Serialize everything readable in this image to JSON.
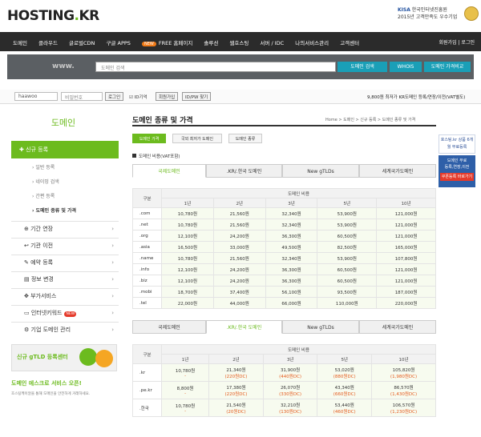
{
  "header": {
    "logo_main": "HOSTING",
    "logo_dot": ".",
    "logo_tail": "KR",
    "kisa_line1_brand": "KISA",
    "kisa_line1": " 한국인터넷진흥원",
    "kisa_line2": "2015년 고객만족도 우수기업"
  },
  "nav": {
    "items": [
      "도메인",
      "클라우드",
      "글로벌CDN",
      "구글 APPS"
    ],
    "new_badge": "NEW",
    "items2": [
      "FREE 홈페이지",
      "솔루션",
      "웹호스팅",
      "서버 / IDC",
      "나의서비스관리",
      "고객센터"
    ],
    "right": "회원가입 | 로그인"
  },
  "search": {
    "www": "www.",
    "placeholder": "도메인 검색",
    "btn_search": "도메인 검색",
    "btn_whois": "WHOIS",
    "btn_compare": "도메인 가격비교"
  },
  "login": {
    "id_value": "haawoo",
    "pw_placeholder": "비밀번호",
    "login_btn": "로그인",
    "save_id": "ID기억",
    "join_btn": "회원가입",
    "find_btn": "ID/PW 찾기",
    "info": "9,800원 최저가 KR도메인 등록/연장/이전(VAT별도)"
  },
  "sidebar": {
    "heading": "도메인",
    "active": "신규 등록",
    "subitems": [
      "일반 등록",
      "네이밍 검색",
      "간편 등록",
      "도메인 종류 및 가격"
    ],
    "menus": [
      {
        "label": "기간 연장"
      },
      {
        "label": "기관 이전"
      },
      {
        "label": "예약 등록"
      },
      {
        "label": "정보 변경"
      },
      {
        "label": "부가서비스"
      },
      {
        "label": "인터넷키워드",
        "badge": "NEW"
      },
      {
        "label": "기업 도메인 관리"
      }
    ],
    "banner1": "신규 gTLD 등록센터",
    "banner2_title": "도메인 에스크로 서비스 오픈!",
    "banner2_sub": "호스팅케이알을 통해 도메인을 안전하게 거래하세요."
  },
  "main": {
    "title": "도메인 종류 및 가격",
    "crumb": "Home > 도메인 > 신규 등록 > 도메인 종류 및 가격",
    "tabs": [
      "도메인 가격",
      "국외 최저가 도메인",
      "도메인 종류"
    ],
    "section_label": "도메인 비용(VAT포함)",
    "tabs2": [
      "국제도메인",
      ".KR/.한국 도메인",
      "New gTLDs",
      "세계국가도메인"
    ],
    "col_label": "구분",
    "group_label": "도메인 비용",
    "periods": [
      "1년",
      "2년",
      "3년",
      "5년",
      "10년"
    ],
    "intl_rows": [
      {
        "name": ".com",
        "vals": [
          "10,780원",
          "21,560원",
          "32,340원",
          "53,900원",
          "121,000원"
        ]
      },
      {
        "name": ".net",
        "vals": [
          "10,780원",
          "21,560원",
          "32,340원",
          "53,900원",
          "121,000원"
        ]
      },
      {
        "name": ".org",
        "vals": [
          "12,100원",
          "24,200원",
          "36,300원",
          "60,500원",
          "121,000원"
        ]
      },
      {
        "name": ".asia",
        "vals": [
          "16,500원",
          "33,000원",
          "49,500원",
          "82,500원",
          "165,000원"
        ]
      },
      {
        "name": ".name",
        "vals": [
          "10,780원",
          "21,560원",
          "32,340원",
          "53,900원",
          "107,800원"
        ]
      },
      {
        "name": ".info",
        "vals": [
          "12,100원",
          "24,200원",
          "36,300원",
          "60,500원",
          "121,000원"
        ]
      },
      {
        "name": ".biz",
        "vals": [
          "12,100원",
          "24,200원",
          "36,300원",
          "60,500원",
          "121,000원"
        ]
      },
      {
        "name": ".mobi",
        "vals": [
          "18,700원",
          "37,400원",
          "56,100원",
          "93,500원",
          "187,000원"
        ]
      },
      {
        "name": ".tel",
        "vals": [
          "22,000원",
          "44,000원",
          "66,000원",
          "110,000원",
          "220,000원"
        ]
      }
    ],
    "kr_rows": [
      {
        "name": ".kr",
        "vals": [
          "10,780원",
          "21,340원",
          "31,900원",
          "53,020원",
          "105,820원"
        ],
        "dc": [
          "-",
          "(220원DC)",
          "(440원DC)",
          "(880원DC)",
          "(1,980원DC)"
        ]
      },
      {
        "name": ".pe.kr",
        "vals": [
          "8,800원",
          "17,380원",
          "26,070원",
          "43,340원",
          "86,570원"
        ],
        "dc": [
          "-",
          "(220원DC)",
          "(330원DC)",
          "(660원DC)",
          "(1,430원DC)"
        ]
      },
      {
        "name": ".한국",
        "vals": [
          "10,780원",
          "21,540원",
          "32,210원",
          "53,440원",
          "106,570원"
        ],
        "dc": [
          "-",
          "(20원DC)",
          "(130원DC)",
          "(460원DC)",
          "(1,230원DC)"
        ]
      }
    ]
  },
  "right_banner": {
    "b1": "호스팅.kr 상품 6개월 무료등록",
    "b2a": "도메인 무료",
    "b2b": "등록,연장,이전",
    "b2c": "쿠폰등록 바로가기"
  }
}
